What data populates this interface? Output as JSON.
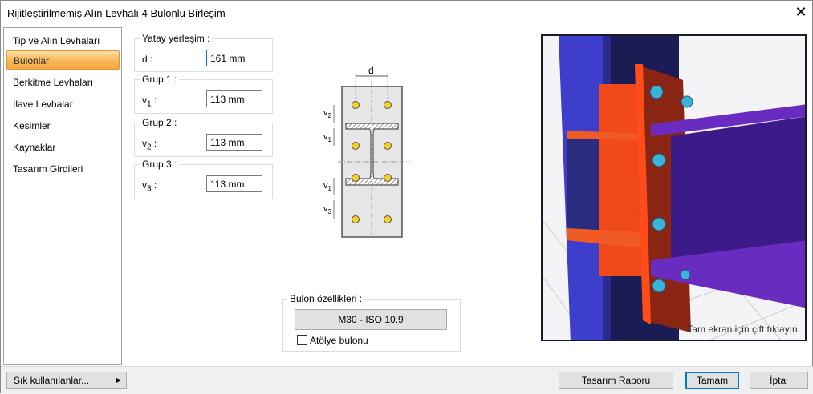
{
  "window": {
    "title": "Rijitleştirilmemiş Alın Levhalı 4 Bulonlu Birleşim",
    "close": "✕"
  },
  "sidebar": {
    "items": [
      {
        "label": "Tip ve Alın Levhaları",
        "selected": false
      },
      {
        "label": "Bulonlar",
        "selected": true
      },
      {
        "label": "Berkitme Levhaları",
        "selected": false
      },
      {
        "label": "İlave Levhalar",
        "selected": false
      },
      {
        "label": "Kesimler",
        "selected": false
      },
      {
        "label": "Kaynaklar",
        "selected": false
      },
      {
        "label": "Tasarım Girdileri",
        "selected": false
      }
    ]
  },
  "groups": {
    "horizontal": {
      "legend": "Yatay yerleşim :",
      "label": "d",
      "value": "161 mm"
    },
    "g1": {
      "legend": "Grup 1 :",
      "label": "v",
      "sub": "1",
      "value": "113 mm"
    },
    "g2": {
      "legend": "Grup 2 :",
      "label": "v",
      "sub": "2",
      "value": "113 mm"
    },
    "g3": {
      "legend": "Grup 3 :",
      "label": "v",
      "sub": "3",
      "value": "113 mm"
    }
  },
  "diagram": {
    "d": "d",
    "v": "v",
    "s1": "1",
    "s2": "2",
    "s3": "3"
  },
  "bolt": {
    "legend": "Bulon özellikleri :",
    "button": "M30 - ISO 10.9",
    "shop_label": "Atölye bulonu",
    "shop_checked": false
  },
  "view": {
    "hint": "Tam ekran için çift tıklayın."
  },
  "footer": {
    "favorites": "Sık kullanılanlar...",
    "report": "Tasarım Raporu",
    "ok": "Tamam",
    "cancel": "İptal"
  }
}
